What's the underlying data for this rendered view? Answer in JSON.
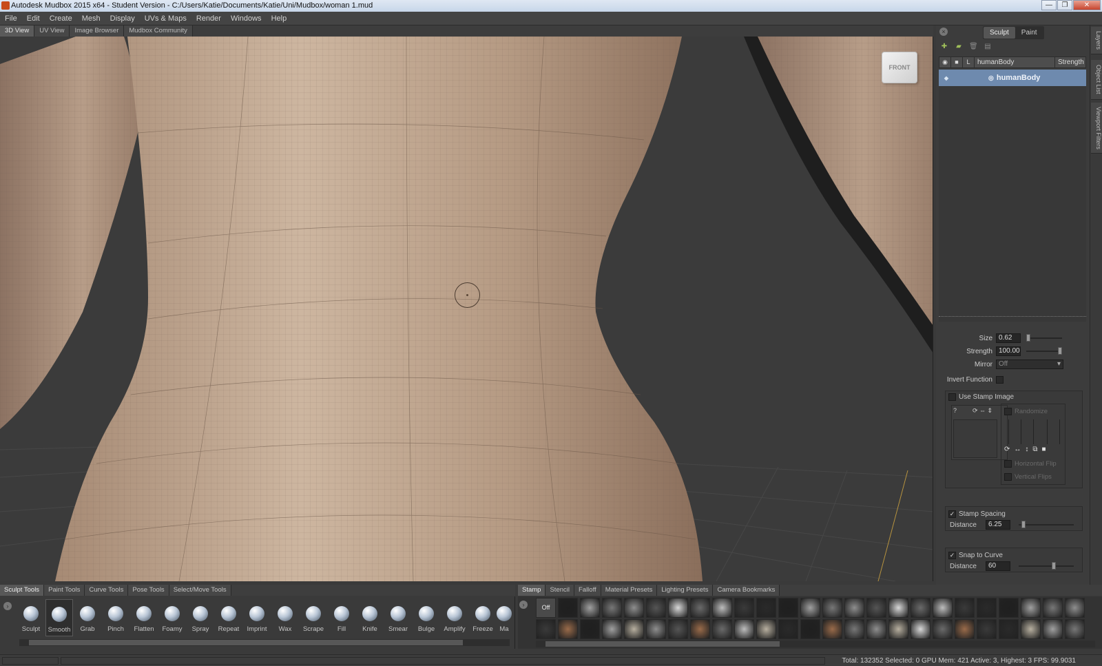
{
  "title_bar": {
    "title": "Autodesk Mudbox 2015 x64 - Student Version - C:/Users/Katie/Documents/Katie/Uni/Mudbox/woman 1.mud",
    "min": "—",
    "max": "❐",
    "close": "✕"
  },
  "menu": [
    "File",
    "Edit",
    "Create",
    "Mesh",
    "Display",
    "UVs & Maps",
    "Render",
    "Windows",
    "Help"
  ],
  "view_tabs": [
    "3D View",
    "UV View",
    "Image Browser",
    "Mudbox Community"
  ],
  "viewcube": {
    "label": "FRONT"
  },
  "right_panel": {
    "tabs": [
      "Sculpt",
      "Paint"
    ],
    "side_tabs": [
      "Layers",
      "Object List",
      "Viewport Filters"
    ],
    "layer_header": {
      "name": "humanBody",
      "strength": "Strength"
    },
    "layer_row": {
      "name": "humanBody"
    },
    "properties": {
      "size_label": "Size",
      "size_value": "0.62",
      "strength_label": "Strength",
      "strength_value": "100.00",
      "mirror_label": "Mirror",
      "mirror_value": "Off",
      "invert_label": "Invert Function",
      "use_stamp_label": "Use Stamp Image",
      "randomize_label": "Randomize",
      "hflip_label": "Horizontal Flip",
      "vflip_label": "Vertical Flips",
      "stamp_spacing_label": "Stamp Spacing",
      "distance_label": "Distance",
      "stamp_distance_value": "6.25",
      "snap_label": "Snap to Curve",
      "snap_distance_value": "60"
    }
  },
  "shelf_tabs": [
    "Sculpt Tools",
    "Paint Tools",
    "Curve Tools",
    "Pose Tools",
    "Select/Move Tools"
  ],
  "tools": [
    "Sculpt",
    "Smooth",
    "Grab",
    "Pinch",
    "Flatten",
    "Foamy",
    "Spray",
    "Repeat",
    "Imprint",
    "Wax",
    "Scrape",
    "Fill",
    "Knife",
    "Smear",
    "Bulge",
    "Amplify",
    "Freeze",
    "Ma"
  ],
  "selected_tool": "Smooth",
  "stamp_tabs": [
    "Stamp",
    "Stencil",
    "Falloff",
    "Material Presets",
    "Lighting Presets",
    "Camera Bookmarks"
  ],
  "stamp_off_label": "Off",
  "status": {
    "text": "Total: 132352  Selected: 0 GPU Mem: 421  Active: 3, Highest: 3  FPS: 99.9031"
  },
  "colors": {
    "skin": "#b59a83",
    "viewport_bg": "#3b3b3b",
    "selection": "#6e8aae"
  }
}
